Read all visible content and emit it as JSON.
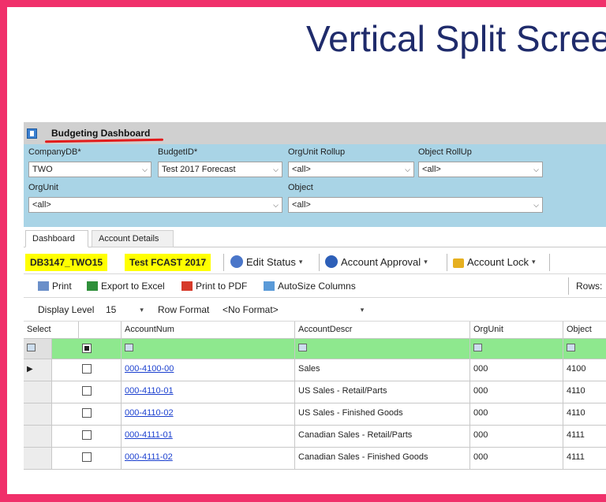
{
  "slide": {
    "title": "Vertical Split Screen"
  },
  "app": {
    "title": "Budgeting Dashboard"
  },
  "filters": {
    "company_label": "CompanyDB*",
    "company_value": "TWO",
    "budget_label": "BudgetID*",
    "budget_value": "Test 2017 Forecast",
    "orgunit_rollup_label": "OrgUnit Rollup",
    "orgunit_rollup_value": "<all>",
    "object_rollup_label": "Object RollUp",
    "object_rollup_value": "<all>",
    "orgunit_label": "OrgUnit",
    "orgunit_value": "<all>",
    "object_label": "Object",
    "object_value": "<all>"
  },
  "tabs": [
    {
      "label": "Dashboard"
    },
    {
      "label": "Account Details"
    }
  ],
  "toolbar1": {
    "chip1": "DB3147_TWO15",
    "chip2": "Test FCAST 2017",
    "edit_status": "Edit Status",
    "account_approval": "Account Approval",
    "account_lock": "Account Lock"
  },
  "toolbar2": {
    "print": "Print",
    "export_excel": "Export to Excel",
    "print_pdf": "Print to PDF",
    "autosize": "AutoSize Columns",
    "rows": "Rows:"
  },
  "toolbar3": {
    "display_level_label": "Display Level",
    "display_level_value": "15",
    "row_format_label": "Row Format",
    "row_format_value": "<No Format>"
  },
  "grid": {
    "headers": {
      "select": "Select",
      "accountnum": "AccountNum",
      "accountdescr": "AccountDescr",
      "orgunit": "OrgUnit",
      "object": "Object"
    },
    "rows": [
      {
        "accountnum": "000-4100-00",
        "accountdescr": "Sales",
        "orgunit": "000",
        "object": "4100"
      },
      {
        "accountnum": "000-4110-01",
        "accountdescr": "US Sales - Retail/Parts",
        "orgunit": "000",
        "object": "4110"
      },
      {
        "accountnum": "000-4110-02",
        "accountdescr": "US Sales - Finished Goods",
        "orgunit": "000",
        "object": "4110"
      },
      {
        "accountnum": "000-4111-01",
        "accountdescr": "Canadian Sales - Retail/Parts",
        "orgunit": "000",
        "object": "4111"
      },
      {
        "accountnum": "000-4111-02",
        "accountdescr": "Canadian Sales - Finished Goods",
        "orgunit": "000",
        "object": "4111"
      }
    ]
  },
  "colors": {
    "frame": "#f0306a",
    "title": "#1f2b6b",
    "filter_panel": "#a9d4e6",
    "chip": "#ffff00",
    "filter_row": "#8ee88e",
    "underline": "#e21b1b"
  },
  "icons": [
    "app-icon",
    "edit-status-icon",
    "account-approval-icon",
    "account-lock-icon",
    "print-icon",
    "excel-icon",
    "pdf-icon",
    "autosize-icon",
    "filter-icon",
    "row-pointer-icon"
  ]
}
